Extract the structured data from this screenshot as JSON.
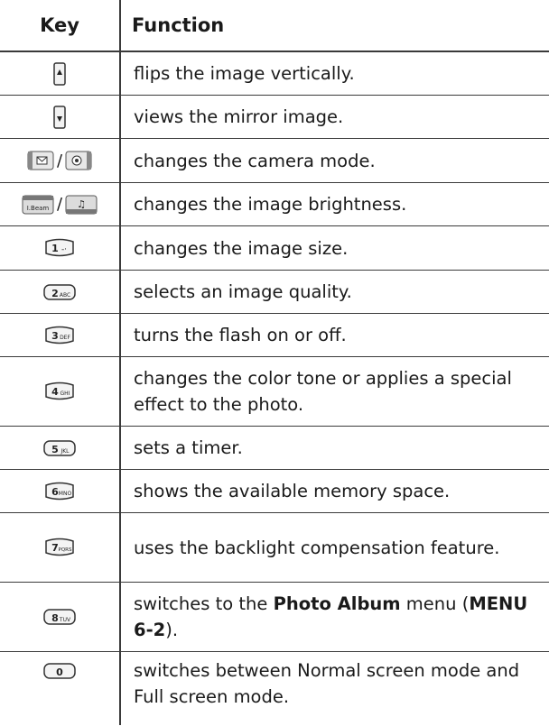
{
  "header": {
    "key": "Key",
    "function": "Function"
  },
  "rows": [
    {
      "key_icons": [
        "volume-up-key-icon"
      ],
      "text": "flips the image vertically."
    },
    {
      "key_icons": [
        "volume-down-key-icon"
      ],
      "text": "views the mirror image."
    },
    {
      "key_icons": [
        "message-soft-key-icon",
        "phonebook-soft-key-icon"
      ],
      "slash": "/",
      "text": "changes the camera mode."
    },
    {
      "key_icons": [
        "beam-key-icon",
        "music-key-icon"
      ],
      "slash": "/",
      "text": "changes the image brightness."
    },
    {
      "key_icons": [
        "key-1-icon"
      ],
      "key_label": "1",
      "text": "changes the image size."
    },
    {
      "key_icons": [
        "key-2-abc-icon"
      ],
      "key_label": "2",
      "key_sub": "ABC",
      "text": "selects an image quality."
    },
    {
      "key_icons": [
        "key-3-def-icon"
      ],
      "key_label": "3",
      "key_sub": "DEF",
      "text": "turns the flash on or off."
    },
    {
      "key_icons": [
        "key-4-ghi-icon"
      ],
      "key_label": "4",
      "key_sub": "GHI",
      "text": "changes the color tone or applies a special effect to the photo."
    },
    {
      "key_icons": [
        "key-5-jkl-icon"
      ],
      "key_label": "5",
      "key_sub": "JKL",
      "text": "sets a timer."
    },
    {
      "key_icons": [
        "key-6-mno-icon"
      ],
      "key_label": "6",
      "key_sub": "MNO",
      "text": "shows the available memory space."
    },
    {
      "key_icons": [
        "key-7-pqrs-icon"
      ],
      "key_label": "7",
      "key_sub": "PQRS",
      "text": "uses the backlight compensation feature."
    },
    {
      "key_icons": [
        "key-8-tuv-icon"
      ],
      "key_label": "8",
      "key_sub": "TUV",
      "text_before": "switches to the ",
      "text_bold1": "Photo Album",
      "text_mid": " menu (",
      "text_bold2": "MENU 6-2",
      "text_after": ")."
    },
    {
      "key_icons": [
        "key-0-icon"
      ],
      "key_label": "0",
      "text": "switches between Normal screen mode and Full screen mode."
    }
  ],
  "beam_label": "I.Beam",
  "music_glyph": "♫",
  "message_glyph": "✉",
  "phone_glyph": "☏"
}
